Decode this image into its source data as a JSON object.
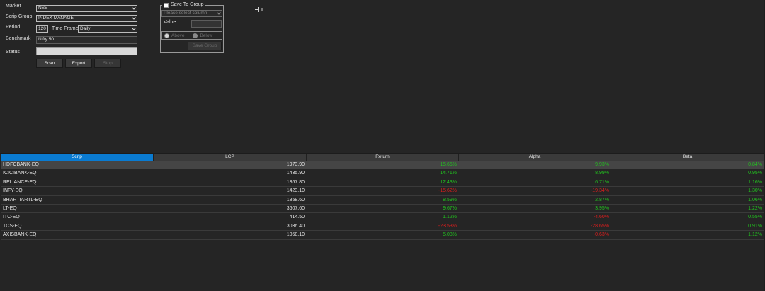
{
  "form": {
    "market_label": "Market",
    "market_value": "NSE",
    "scrip_group_label": "Scrip Group",
    "scrip_group_value": "INDEX MANAGE",
    "period_label": "Period",
    "period_value": "120",
    "time_frame_label": "Time Frame",
    "time_frame_value": "Daily",
    "benchmark_label": "Benchmark",
    "benchmark_value": "Nifty 50",
    "status_label": "Status",
    "status_value": ""
  },
  "buttons": {
    "scan": "Scan",
    "export": "Export",
    "stop": "Stop"
  },
  "save_group": {
    "title": "Save To Group",
    "column_placeholder": "Please select column",
    "value_label": "Value :",
    "value_value": "",
    "above_label": "Above",
    "below_label": "Below",
    "save_button": "Save Group"
  },
  "grid": {
    "columns": [
      "Scrip",
      "LCP",
      "Return",
      "Alpha",
      "Beta"
    ],
    "rows": [
      {
        "scrip": "HDFCBANK-EQ",
        "lcp": "1973.90",
        "ret": "15.65%",
        "alpha": "9.93%",
        "beta": "0.84%"
      },
      {
        "scrip": "ICICIBANK-EQ",
        "lcp": "1435.90",
        "ret": "14.71%",
        "alpha": "8.99%",
        "beta": "0.95%"
      },
      {
        "scrip": "RELIANCE-EQ",
        "lcp": "1367.80",
        "ret": "12.43%",
        "alpha": "6.71%",
        "beta": "1.16%"
      },
      {
        "scrip": "INFY-EQ",
        "lcp": "1423.10",
        "ret": "-15.62%",
        "alpha": "-19.34%",
        "beta": "1.30%"
      },
      {
        "scrip": "BHARTIARTL-EQ",
        "lcp": "1858.60",
        "ret": "8.59%",
        "alpha": "2.87%",
        "beta": "1.06%"
      },
      {
        "scrip": "LT-EQ",
        "lcp": "3607.60",
        "ret": "9.67%",
        "alpha": "3.95%",
        "beta": "1.22%"
      },
      {
        "scrip": "ITC-EQ",
        "lcp": "414.50",
        "ret": "1.12%",
        "alpha": "-4.60%",
        "beta": "0.55%"
      },
      {
        "scrip": "TCS-EQ",
        "lcp": "3036.40",
        "ret": "-23.53%",
        "alpha": "-28.65%",
        "beta": "0.91%"
      },
      {
        "scrip": "AXISBANK-EQ",
        "lcp": "1058.10",
        "ret": "5.08%",
        "alpha": "-0.63%",
        "beta": "1.12%"
      }
    ]
  },
  "colors": {
    "background": "#252525",
    "positive": "#22c21f",
    "negative": "#e01d1d",
    "header_active": "#0a7bd1"
  },
  "icons": {
    "pin": "pin-icon",
    "dropdown": "chevron-down-icon"
  }
}
